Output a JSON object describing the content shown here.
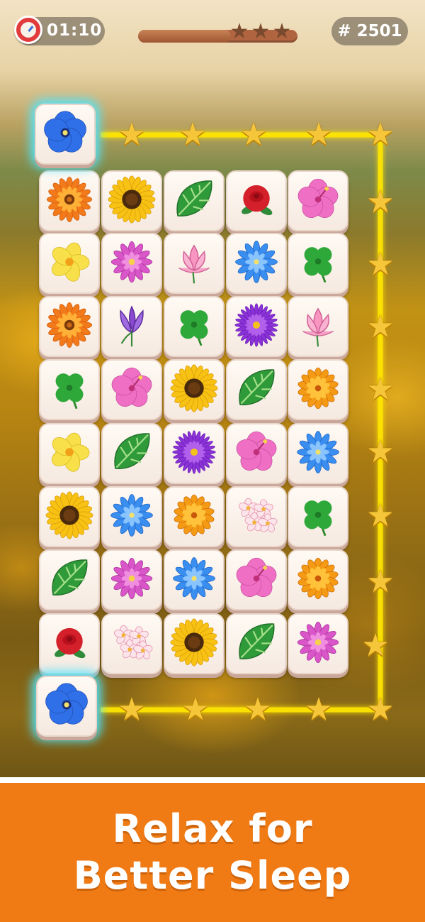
{
  "hud": {
    "timer": "01:10",
    "progress": 0.58,
    "stars_earned": 0,
    "stars_total": 3,
    "level": "# 2501"
  },
  "board": {
    "selected_tiles": [
      {
        "type": "blue-flower"
      },
      {
        "type": "blue-flower"
      }
    ],
    "rows": [
      [
        "orange-gerbera",
        "sunflower",
        "monstera-leaf",
        "red-rose",
        "pink-hibiscus"
      ],
      [
        "yellow-plumeria",
        "pink-dahlia",
        "pink-lotus",
        "blue-dahlia",
        "clover"
      ],
      [
        "orange-gerbera-2",
        "crocus",
        "clover",
        "purple-aster",
        "pink-lotus"
      ],
      [
        "clover",
        "pink-hibiscus",
        "sunflower",
        "monstera-leaf",
        "orange-marigold"
      ],
      [
        "yellow-plumeria",
        "monstera-leaf",
        "purple-aster",
        "pink-hibiscus",
        "blue-dahlia"
      ],
      [
        "sunflower",
        "blue-dahlia",
        "orange-marigold",
        "plumeria-cluster",
        "clover"
      ],
      [
        "monstera-leaf",
        "pink-dahlia",
        "blue-dahlia",
        "pink-hibiscus",
        "orange-marigold"
      ],
      [
        "red-rose",
        "plumeria-cluster",
        "sunflower",
        "monstera-leaf",
        "pink-dahlia"
      ]
    ]
  },
  "colors": {
    "path_line": "#ffe600",
    "path_star": "#f6c63a",
    "banner": "#f07a14",
    "selection_glow": "#50e6ff"
  },
  "banner": {
    "line1": "Relax for",
    "line2": "Better Sleep"
  }
}
